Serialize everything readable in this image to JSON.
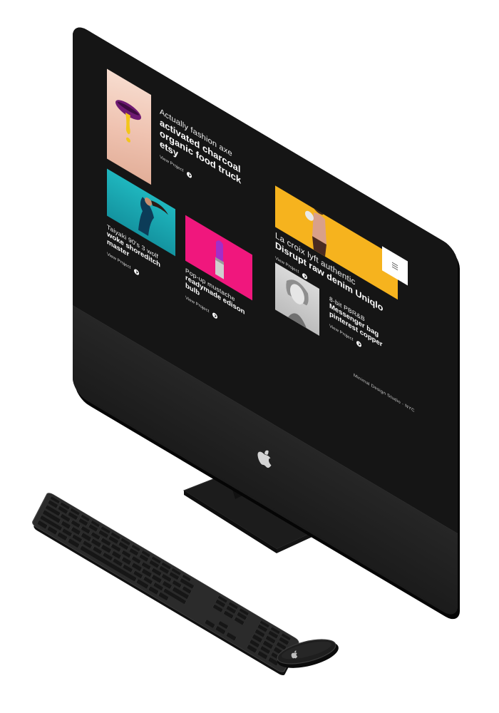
{
  "portfolio": {
    "projects": [
      {
        "eyebrow": "Actually fashion axe",
        "headline": "activated charcoal organic food truck etsy",
        "link": "View Project"
      },
      {
        "eyebrow": "Taiyaki 90's 3 wolf",
        "headline": "woke shoreditch master",
        "link": "View Project"
      },
      {
        "eyebrow": "Pop-up mustache",
        "headline": "readymade edison bulb",
        "link": "View Project"
      },
      {
        "eyebrow": "La croix lyft authentic",
        "headline": "Disrupt raw denim Uniqlo",
        "link": "View Project"
      },
      {
        "eyebrow": "8-bit PBR&B",
        "headline": "Messenger bag pinterest copper",
        "link": "View Project"
      }
    ],
    "footer": "Minimal Design Studio - NYC"
  },
  "icons": {
    "menu": "hamburger-menu-icon",
    "arrow": "arrow-right-icon",
    "brand": "apple-logo-icon"
  },
  "colors": {
    "screen_background": "#151515",
    "accent_yellow": "#f6b31e",
    "accent_pink": "#f0177d",
    "accent_teal": "#1aa6b0",
    "accent_purple": "#a22ec9"
  }
}
